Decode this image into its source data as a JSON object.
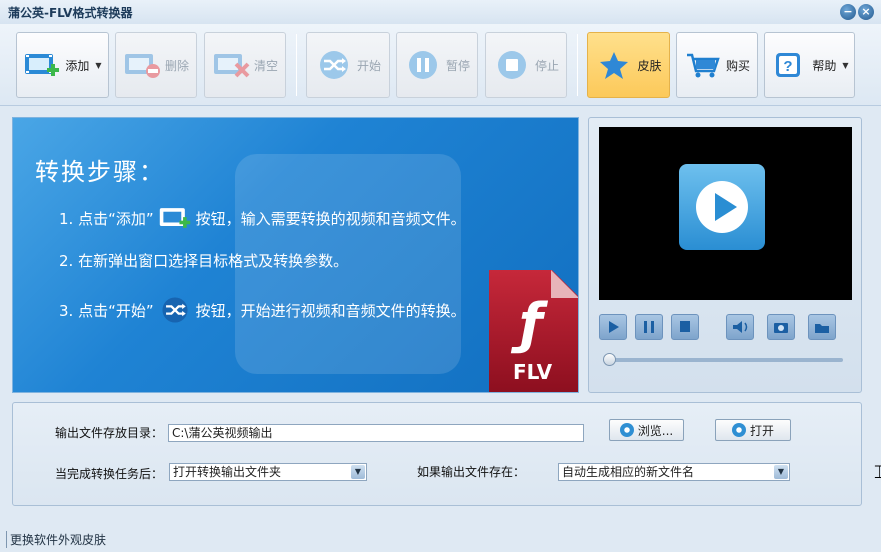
{
  "window": {
    "title": "蒲公英-FLV格式转换器",
    "min_glyph": "−",
    "close_glyph": "×"
  },
  "toolbar": {
    "add": {
      "label": "添加",
      "icon": "film-add-icon",
      "has_dropdown": true
    },
    "delete": {
      "label": "删除",
      "icon": "film-remove-icon"
    },
    "clear": {
      "label": "清空",
      "icon": "film-clear-icon"
    },
    "start": {
      "label": "开始",
      "icon": "shuffle-convert-icon"
    },
    "pause": {
      "label": "暂停",
      "icon": "pause-icon"
    },
    "stop": {
      "label": "停止",
      "icon": "stop-icon"
    },
    "skin": {
      "label": "皮肤",
      "icon": "star-icon"
    },
    "buy": {
      "label": "购买",
      "icon": "cart-icon"
    },
    "help": {
      "label": "帮助",
      "icon": "help-icon",
      "has_dropdown": true
    }
  },
  "guide": {
    "title": "转换步骤：",
    "step1_pre": "1. 点击“添加”",
    "step1_post": "按钮，输入需要转换的视频和音频文件。",
    "step2": "2. 在新弹出窗口选择目标格式及转换参数。",
    "step3_pre": "3. 点击“开始”",
    "step3_post": "按钮，开始进行视频和音频文件的转换。",
    "badge_text": "FLV"
  },
  "settings": {
    "output_dir_label": "输出文件存放目录：",
    "output_dir_value": "C:\\蒲公英视频输出",
    "browse_label": "浏览...",
    "open_label": "打开",
    "after_task_label": "当完成转换任务后：",
    "after_task_value": "打开转换输出文件夹",
    "if_exists_label": "如果输出文件存在：",
    "if_exists_value": "自动生成相应的新文件名"
  },
  "status": {
    "text": "更换软件外观皮肤"
  },
  "colors": {
    "accent": "#1f83d4",
    "skin_active": "#fcc95a",
    "flv_red": "#c6283a"
  }
}
